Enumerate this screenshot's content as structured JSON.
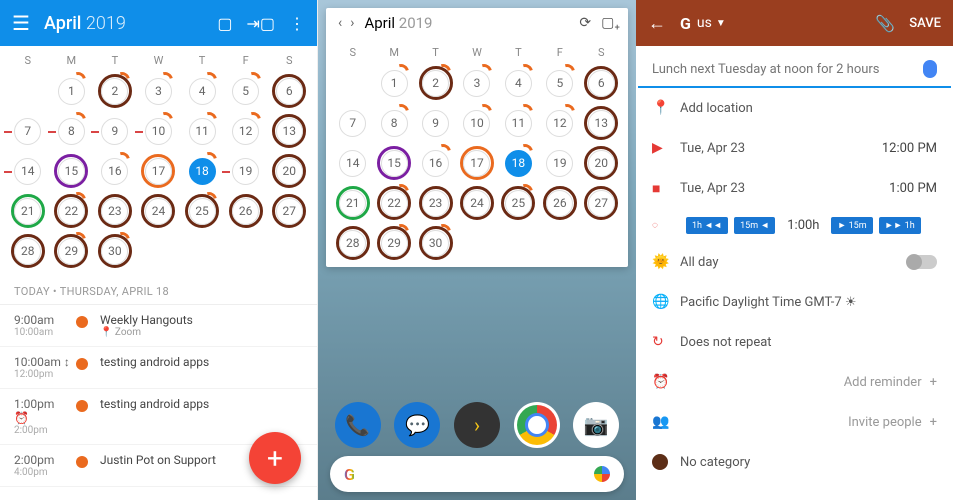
{
  "pane1": {
    "month": "April",
    "year": "2019",
    "dow": [
      "S",
      "M",
      "T",
      "W",
      "T",
      "F",
      "S"
    ],
    "days": [
      [
        {
          "n": ""
        },
        {
          "n": "1",
          "arc": true
        },
        {
          "n": "2",
          "ring": "dark",
          "arc": true
        },
        {
          "n": "3",
          "arc": true
        },
        {
          "n": "4",
          "arc": true
        },
        {
          "n": "5",
          "arc": true
        },
        {
          "n": "6",
          "ring": "dark"
        }
      ],
      [
        {
          "n": "7",
          "dash": true
        },
        {
          "n": "8",
          "dash": true,
          "arc": true
        },
        {
          "n": "9",
          "dash": true
        },
        {
          "n": "10",
          "dash": true,
          "arc": true
        },
        {
          "n": "11",
          "arc": true
        },
        {
          "n": "12",
          "arc": true
        },
        {
          "n": "13",
          "ring": "dark"
        }
      ],
      [
        {
          "n": "14",
          "dash": true
        },
        {
          "n": "15",
          "ring": "purple"
        },
        {
          "n": "16",
          "arc": true
        },
        {
          "n": "17",
          "ring": "orange"
        },
        {
          "n": "18",
          "today": true,
          "arc": true
        },
        {
          "n": "19",
          "dash": true
        },
        {
          "n": "20",
          "ring": "dark"
        }
      ],
      [
        {
          "n": "21",
          "ring": "green"
        },
        {
          "n": "22",
          "ring": "dark",
          "arc": true
        },
        {
          "n": "23",
          "ring": "dark"
        },
        {
          "n": "24",
          "ring": "dark"
        },
        {
          "n": "25",
          "ring": "dark",
          "arc": true
        },
        {
          "n": "26",
          "ring": "dark"
        },
        {
          "n": "27",
          "ring": "dark"
        }
      ],
      [
        {
          "n": "28",
          "ring": "dark"
        },
        {
          "n": "29",
          "ring": "dark",
          "arc": true
        },
        {
          "n": "30",
          "ring": "dark",
          "arc": true
        },
        {
          "n": ""
        },
        {
          "n": ""
        },
        {
          "n": ""
        },
        {
          "n": ""
        }
      ]
    ],
    "today_label": "TODAY • THURSDAY, APRIL 18",
    "events": [
      {
        "t1": "9:00am",
        "t2": "10:00am",
        "title": "Weekly Hangouts",
        "loc": "Zoom"
      },
      {
        "t1": "10:00am",
        "t2": "12:00pm",
        "title": "testing android apps",
        "icon": "↕"
      },
      {
        "t1": "1:00pm",
        "t2": "2:00pm",
        "title": "testing android apps",
        "icon": "⏰"
      },
      {
        "t1": "2:00pm",
        "t2": "4:00pm",
        "title": "Justin Pot on Support"
      }
    ]
  },
  "pane2": {
    "month": "April",
    "year": "2019",
    "dow": [
      "S",
      "M",
      "T",
      "W",
      "T",
      "F",
      "S"
    ],
    "days": [
      [
        {
          "n": ""
        },
        {
          "n": "1",
          "arc": true
        },
        {
          "n": "2",
          "ring": "dark",
          "arc": true
        },
        {
          "n": "3",
          "arc": true
        },
        {
          "n": "4",
          "arc": true
        },
        {
          "n": "5",
          "arc": true
        },
        {
          "n": "6",
          "ring": "dark"
        }
      ],
      [
        {
          "n": "7"
        },
        {
          "n": "8",
          "arc": true
        },
        {
          "n": "9"
        },
        {
          "n": "10",
          "arc": true
        },
        {
          "n": "11",
          "arc": true
        },
        {
          "n": "12",
          "arc": true
        },
        {
          "n": "13",
          "ring": "dark"
        }
      ],
      [
        {
          "n": "14"
        },
        {
          "n": "15",
          "ring": "purple"
        },
        {
          "n": "16",
          "arc": true
        },
        {
          "n": "17",
          "ring": "orange"
        },
        {
          "n": "18",
          "today": true,
          "arc": true
        },
        {
          "n": "19"
        },
        {
          "n": "20",
          "ring": "dark"
        }
      ],
      [
        {
          "n": "21",
          "ring": "green"
        },
        {
          "n": "22",
          "ring": "dark",
          "arc": true
        },
        {
          "n": "23",
          "ring": "dark"
        },
        {
          "n": "24",
          "ring": "dark"
        },
        {
          "n": "25",
          "ring": "dark",
          "arc": true
        },
        {
          "n": "26",
          "ring": "dark"
        },
        {
          "n": "27",
          "ring": "dark"
        }
      ],
      [
        {
          "n": "28",
          "ring": "dark"
        },
        {
          "n": "29",
          "ring": "dark",
          "arc": true
        },
        {
          "n": "30",
          "ring": "dark",
          "arc": true
        },
        {
          "n": ""
        },
        {
          "n": ""
        },
        {
          "n": ""
        },
        {
          "n": ""
        }
      ]
    ],
    "search": "G"
  },
  "pane3": {
    "account": "us",
    "save": "SAVE",
    "placeholder": "Lunch next Tuesday at noon for 2 hours",
    "location": "Add location",
    "start_date": "Tue, Apr 23",
    "start_time": "12:00 PM",
    "end_date": "Tue, Apr 23",
    "end_time": "1:00 PM",
    "dur_back1h": "1h ◄◄",
    "dur_back15": "15m ◄",
    "duration": "1:00h",
    "dur_fwd15": "► 15m",
    "dur_fwd1h": "►► 1h",
    "allday": "All day",
    "tz": "Pacific Daylight Time GMT-7 ☀",
    "repeat": "Does not repeat",
    "reminder": "Add reminder",
    "invite": "Invite people",
    "category": "No category"
  }
}
